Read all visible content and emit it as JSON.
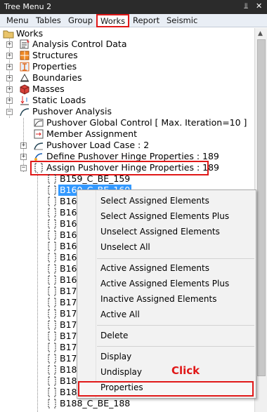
{
  "window": {
    "title": "Tree Menu 2",
    "pin_glyph": "⫫",
    "close_glyph": "✕"
  },
  "tabs": [
    {
      "label": "Menu"
    },
    {
      "label": "Tables"
    },
    {
      "label": "Group"
    },
    {
      "label": "Works"
    },
    {
      "label": "Report"
    },
    {
      "label": "Seismic"
    }
  ],
  "tree": {
    "root": "Works",
    "items": [
      {
        "label": "Analysis Control Data",
        "icon": "analysis-control-icon"
      },
      {
        "label": "Structures",
        "icon": "structures-icon"
      },
      {
        "label": "Properties",
        "icon": "properties-icon"
      },
      {
        "label": "Boundaries",
        "icon": "boundaries-icon"
      },
      {
        "label": "Masses",
        "icon": "masses-icon"
      },
      {
        "label": "Static Loads",
        "icon": "static-loads-icon"
      },
      {
        "label": "Pushover Analysis",
        "icon": "pushover-icon"
      }
    ],
    "pushover_children": [
      {
        "label": "Pushover Global Control [ Max. Iteration=10 ]"
      },
      {
        "label": "Member Assignment"
      },
      {
        "label": "Pushover Load Case : 2"
      },
      {
        "label": "Define Pushover Hinge Properties : 189"
      },
      {
        "label": "Assign Pushover Hinge Properties : 189"
      }
    ],
    "hinges": [
      "B159_C_BE_159",
      "B160_C_BE_160",
      "B16",
      "B16",
      "B16",
      "B16",
      "B16",
      "B16",
      "B16",
      "B16",
      "B17",
      "B17",
      "B17",
      "B17",
      "B17",
      "B17",
      "B17",
      "B18",
      "B18",
      "B18",
      "B188_C_BE_188"
    ]
  },
  "context_menu": {
    "groups": [
      [
        "Select Assigned Elements",
        "Select Assigned Elements Plus",
        "Unselect Assigned Elements",
        "Unselect All"
      ],
      [
        "Active Assigned Elements",
        "Active Assigned Elements Plus",
        "Inactive Assigned Elements",
        "Active All"
      ],
      [
        "Delete"
      ],
      [
        "Display",
        "Undisplay"
      ],
      [
        "Properties"
      ]
    ]
  },
  "annotation": {
    "click_label": "Click"
  },
  "colors": {
    "highlight_red": "#e01818",
    "selection_blue": "#3399ff",
    "titlebar": "#2b2b2b"
  }
}
